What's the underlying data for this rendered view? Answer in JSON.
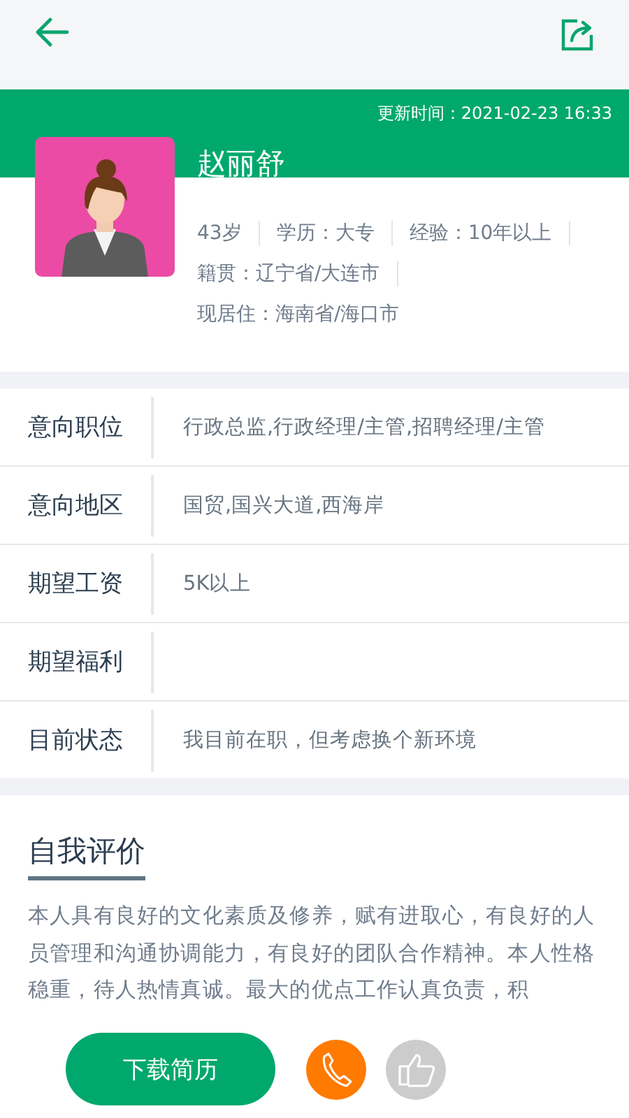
{
  "updated": "更新时间：2021-02-23 16:33",
  "name": "赵丽舒",
  "info_lines": [
    [
      "43岁",
      "学历：大专",
      "经验：10年以上"
    ],
    [
      "籍贯：辽宁省/大连市"
    ],
    [
      "现居住：海南省/海口市"
    ]
  ],
  "fields": [
    {
      "label": "意向职位",
      "value": "行政总监,行政经理/主管,招聘经理/主管"
    },
    {
      "label": "意向地区",
      "value": "国贸,国兴大道,西海岸"
    },
    {
      "label": "期望工资",
      "value": "5K以上"
    },
    {
      "label": "期望福利"
    },
    {
      "label": "目前状态",
      "value": "我目前在职，但考虑换个新环境"
    }
  ],
  "self_evaluation": {
    "title": "自我评价",
    "text": "本人具有良好的文化素质及修养，赋有进取心，有良好的人员管理和沟通协调能力，有良好的团队合作精神。本人性格稳重，待人热情真诚。最大的优点工作认真负责，积"
  },
  "download_button": "下载简历",
  "liked": false
}
